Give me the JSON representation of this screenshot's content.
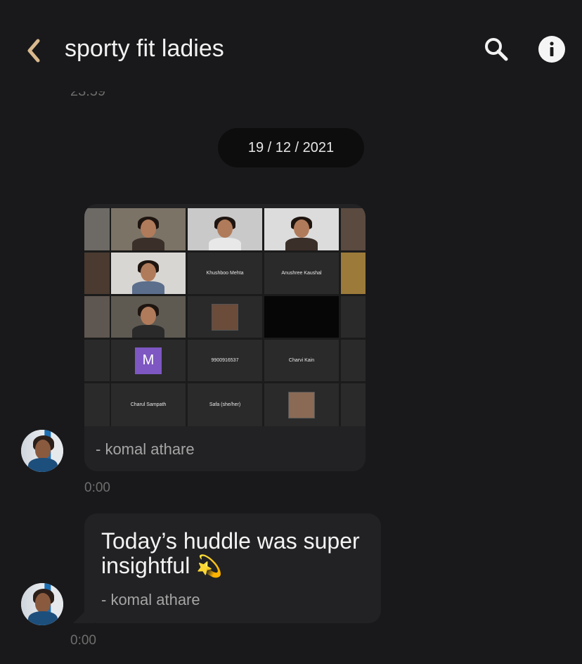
{
  "header": {
    "title": "sporty fit ladies",
    "back_icon": "chevron-left-icon",
    "search_icon": "search-icon",
    "info_icon": "info-icon",
    "accent_color": "#d9b98e"
  },
  "conversation": {
    "cut_off_time": "23:59",
    "date_separator": "19 / 12 / 2021",
    "messages": [
      {
        "type": "image",
        "caption": "- komal athare",
        "time": "0:00",
        "participants": [
          "Khushboo Mehta",
          "Anushree Kaushal",
          "M",
          "9900916537",
          "Charvi Kain",
          "Charul Sampath",
          "Safa (she/her)"
        ]
      },
      {
        "type": "text",
        "text": "Today’s huddle was super insightful",
        "emoji": "💫",
        "sender": "- komal athare",
        "time": "0:00"
      }
    ]
  }
}
